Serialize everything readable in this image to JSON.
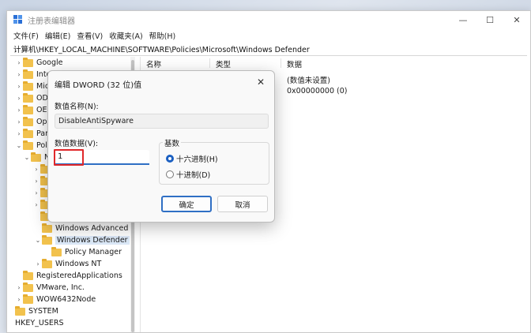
{
  "window": {
    "title": "注册表编辑器",
    "controls": {
      "minimize": "—",
      "maximize": "☐",
      "close": "✕"
    }
  },
  "menu": [
    "文件(F)",
    "编辑(E)",
    "查看(V)",
    "收藏夹(A)",
    "帮助(H)"
  ],
  "address": "计算机\\HKEY_LOCAL_MACHINE\\SOFTWARE\\Policies\\Microsoft\\Windows Defender",
  "tree": [
    {
      "label": "Google",
      "chevron": "›"
    },
    {
      "label": "Intel",
      "chevron": "›"
    },
    {
      "label": "Mic",
      "chevron": "›"
    },
    {
      "label": "OD",
      "chevron": "›"
    },
    {
      "label": "OEI",
      "chevron": "›"
    },
    {
      "label": "Ope",
      "chevron": "›"
    },
    {
      "label": "Par",
      "chevron": "›"
    },
    {
      "label": "Poli",
      "chevron": "⌄"
    },
    {
      "label": "N",
      "chevron": "⌄"
    },
    {
      "label": "",
      "chevron": "›"
    },
    {
      "label": "",
      "chevron": "›"
    },
    {
      "label": "",
      "chevron": "›"
    },
    {
      "label": "",
      "chevron": "›"
    },
    {
      "label": "",
      "chevron": ""
    },
    {
      "label": "Windows Advanced",
      "chevron": ""
    },
    {
      "label": "Windows Defender",
      "chevron": "⌄"
    },
    {
      "label": "Policy Manager",
      "chevron": ""
    },
    {
      "label": "Windows NT",
      "chevron": "›"
    },
    {
      "label": "RegisteredApplications",
      "chevron": ""
    },
    {
      "label": "VMware, Inc.",
      "chevron": "›"
    },
    {
      "label": "WOW6432Node",
      "chevron": "›"
    },
    {
      "label": "SYSTEM",
      "chevron": ""
    },
    {
      "label": "HKEY_USERS",
      "chevron": ""
    }
  ],
  "list": {
    "headers": {
      "name": "名称",
      "type": "类型",
      "data": "数据"
    },
    "rows": [
      {
        "data": "(数值未设置)"
      },
      {
        "data": "0x00000000 (0)"
      }
    ]
  },
  "dialog": {
    "title": "编辑 DWORD (32 位)值",
    "close": "✕",
    "name_label": "数值名称(N):",
    "name_value": "DisableAntiSpyware",
    "data_label": "数值数据(V):",
    "data_value": "1",
    "base_label": "基数",
    "hex_label": "十六进制(H)",
    "dec_label": "十进制(D)",
    "ok": "确定",
    "cancel": "取消"
  }
}
